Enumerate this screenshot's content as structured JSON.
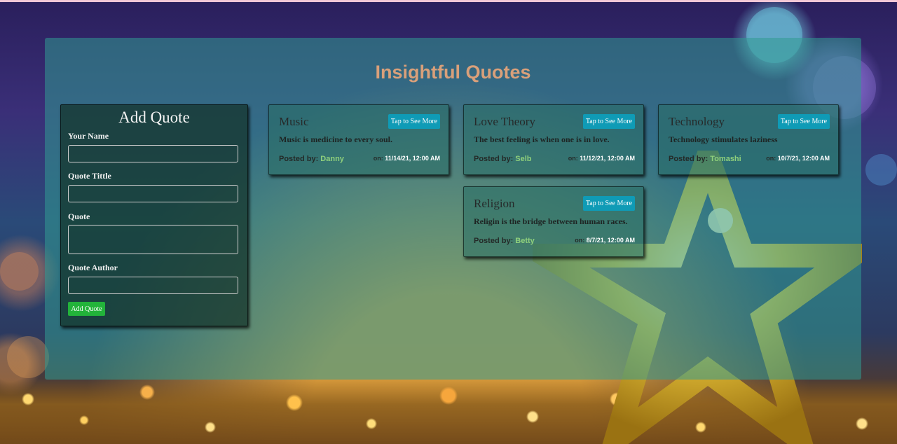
{
  "page": {
    "title": "Insightful Quotes",
    "colors": {
      "panel": "#329b91",
      "title": "#d9a07a",
      "add_button": "#22b33a",
      "see_more_button": "#0f9bb6",
      "author": "#8fd07c"
    }
  },
  "form": {
    "title": "Add Quote",
    "name_label": "Your Name",
    "name_value": "",
    "title_label": "Quote Tittle",
    "title_value": "",
    "quote_label": "Quote",
    "quote_value": "",
    "author_label": "Quote Author",
    "author_value": "",
    "submit_label": "Add Quote"
  },
  "quotes": [
    {
      "title": "Music",
      "button": "Tap to See More",
      "text": "Music is medicine to every soul.",
      "posted_label": "Posted by:",
      "author": "Danny",
      "on_label": "on:",
      "date": "11/14/21, 12:00 AM"
    },
    {
      "title": "Love Theory",
      "button": "Tap to See More",
      "text": "The best feeling is when one is in love.",
      "posted_label": "Posted by:",
      "author": "Selb",
      "on_label": "on:",
      "date": "11/12/21, 12:00 AM"
    },
    {
      "title": "Technology",
      "button": "Tap to See More",
      "text": "Technology stimulates laziness",
      "posted_label": "Posted by:",
      "author": "Tomashi",
      "on_label": "on:",
      "date": "10/7/21, 12:00 AM"
    },
    {
      "title": "Religion",
      "button": "Tap to See More",
      "text": "Religin is the bridge between human races.",
      "posted_label": "Posted by:",
      "author": "Betty",
      "on_label": "on:",
      "date": "8/7/21, 12:00 AM"
    }
  ]
}
